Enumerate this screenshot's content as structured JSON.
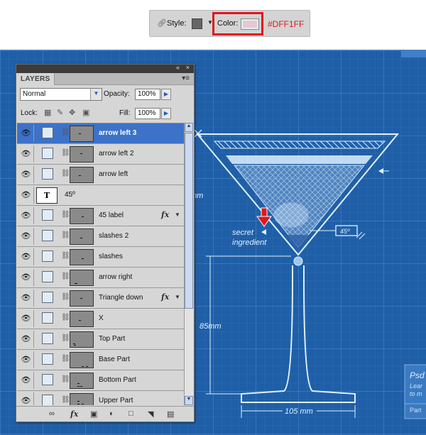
{
  "style_bar": {
    "style_label": "Style:",
    "color_label": "Color:",
    "color_hex": "#DFF1FF",
    "swatch_color": "#666666",
    "color_value": "#DFF1FF"
  },
  "blueprint": {
    "dim_top": "mm",
    "dim_height": "85mm",
    "dim_base": "105 mm",
    "angle_label": "45º",
    "annotation_line1": "secret",
    "annotation_line2": "ingredient",
    "side_card_title": "Psd",
    "side_card_line1": "Lear",
    "side_card_line2": "to m",
    "side_card_footer": "Part",
    "background_color": "#1f5fa7",
    "line_color": "#dff1ff",
    "marker_color": "#e1161d"
  },
  "layers_panel": {
    "tab_label": "LAYERS",
    "blend_mode": "Normal",
    "opacity_label": "Opacity:",
    "opacity_value": "100%",
    "lock_label": "Lock:",
    "fill_label": "Fill:",
    "fill_value": "100%",
    "layers": [
      {
        "name": "arrow left 3",
        "selected": true,
        "type": "shape",
        "fx": false
      },
      {
        "name": "arrow left 2",
        "selected": false,
        "type": "shape",
        "fx": false
      },
      {
        "name": "arrow left",
        "selected": false,
        "type": "shape",
        "fx": false
      },
      {
        "name": "45º",
        "selected": false,
        "type": "text",
        "fx": false
      },
      {
        "name": "45 label",
        "selected": false,
        "type": "shape",
        "fx": true
      },
      {
        "name": "slashes 2",
        "selected": false,
        "type": "shape",
        "fx": false
      },
      {
        "name": "slashes",
        "selected": false,
        "type": "shape",
        "fx": false
      },
      {
        "name": "arrow right",
        "selected": false,
        "type": "shape",
        "fx": false
      },
      {
        "name": "Triangle down",
        "selected": false,
        "type": "shape",
        "fx": true
      },
      {
        "name": "X",
        "selected": false,
        "type": "shape",
        "fx": false
      },
      {
        "name": "Top Part",
        "selected": false,
        "type": "shape",
        "fx": false
      },
      {
        "name": "Base Part",
        "selected": false,
        "type": "shape",
        "fx": false
      },
      {
        "name": "Bottom Part",
        "selected": false,
        "type": "shape",
        "fx": false
      },
      {
        "name": "Upper Part",
        "selected": false,
        "type": "shape",
        "fx": false
      }
    ],
    "type_glyph": "T",
    "fx_glyph": "fx",
    "footer_icons": [
      "link-icon",
      "fx-icon",
      "mask-icon",
      "adjustment-icon",
      "folder-icon",
      "new-layer-icon",
      "trash-icon"
    ]
  }
}
